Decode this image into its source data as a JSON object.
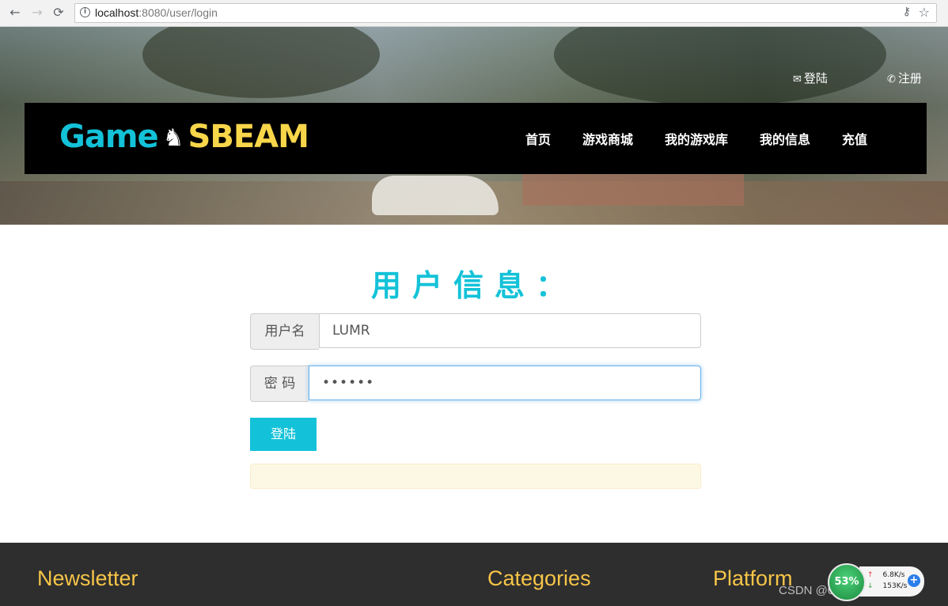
{
  "browser": {
    "url_host": "localhost",
    "url_path": ":8080/user/login",
    "icons": [
      "back-icon",
      "forward-icon",
      "reload-icon",
      "info-icon",
      "key-icon",
      "star-icon"
    ]
  },
  "header": {
    "top_links": {
      "login": "登陆",
      "register": "注册"
    },
    "logo": {
      "game": "Game",
      "knight": "♞",
      "sbeam": "SBEAM"
    },
    "menu": [
      "首页",
      "游戏商城",
      "我的游戏库",
      "我的信息",
      "充值"
    ]
  },
  "main": {
    "title": "用户信息：",
    "username": {
      "label": "用户名",
      "value": "LUMR"
    },
    "password": {
      "label": "密 码",
      "value": "••••••"
    },
    "login_button": "登陆",
    "alert": ""
  },
  "footer": {
    "headings": [
      "Newsletter",
      "Categories",
      "Platform"
    ]
  },
  "overlay": {
    "watermark": "CSDN @0028920414822",
    "gauge_percent": "53%",
    "upload_speed": "6.8K/s",
    "download_speed": "153K/s"
  },
  "colors": {
    "accent": "#13c2d8",
    "logo_yellow": "#f7d64a",
    "footer_heading": "#f7c548",
    "navbar_bg": "#000000",
    "footer_bg": "#2e2e2e"
  }
}
